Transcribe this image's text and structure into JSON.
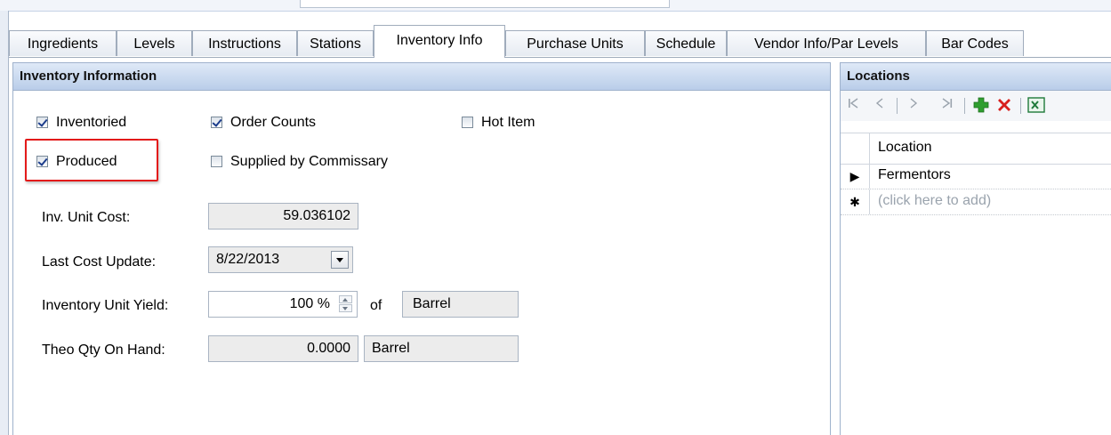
{
  "tabs": [
    {
      "label": "Ingredients",
      "active": false
    },
    {
      "label": "Levels",
      "active": false
    },
    {
      "label": "Instructions",
      "active": false
    },
    {
      "label": "Stations",
      "active": false
    },
    {
      "label": "Inventory Info",
      "active": true
    },
    {
      "label": "Purchase Units",
      "active": false
    },
    {
      "label": "Schedule",
      "active": false
    },
    {
      "label": "Vendor Info/Par Levels",
      "active": false
    },
    {
      "label": "Bar Codes",
      "active": false
    }
  ],
  "inventory": {
    "header": "Inventory Information",
    "checkboxes": {
      "inventoried": {
        "label": "Inventoried",
        "checked": true
      },
      "order_counts": {
        "label": "Order Counts",
        "checked": true
      },
      "hot_item": {
        "label": "Hot Item",
        "checked": false
      },
      "produced": {
        "label": "Produced",
        "checked": true
      },
      "supplied": {
        "label": "Supplied by Commissary",
        "checked": false
      }
    },
    "fields": {
      "unit_cost": {
        "label": "Inv. Unit Cost:",
        "value": "59.036102"
      },
      "last_update": {
        "label": "Last Cost Update:",
        "value": "8/22/2013"
      },
      "unit_yield": {
        "label": "Inventory Unit Yield:",
        "value": "100 %",
        "of_label": "of",
        "unit": "Barrel"
      },
      "theo_qty": {
        "label": "Theo Qty On Hand:",
        "value": "0.0000",
        "unit": "Barrel"
      }
    }
  },
  "locations": {
    "header": "Locations",
    "column": "Location",
    "rows": [
      "Fermentors"
    ],
    "new_row_placeholder": "(click here to add)",
    "row_marker": "▶",
    "new_row_marker": "✱"
  },
  "icons": {
    "first": "first-record-icon",
    "prev": "previous-record-icon",
    "next": "next-record-icon",
    "last": "last-record-icon",
    "add": "add-icon",
    "delete": "delete-icon",
    "excel": "excel-export-icon"
  },
  "colors": {
    "header_blue": "#c9d9ef",
    "highlight_red": "#e31a1a",
    "add_green": "#2f9e2f",
    "delete_red": "#d8201e",
    "excel_green": "#1f7a3a"
  }
}
